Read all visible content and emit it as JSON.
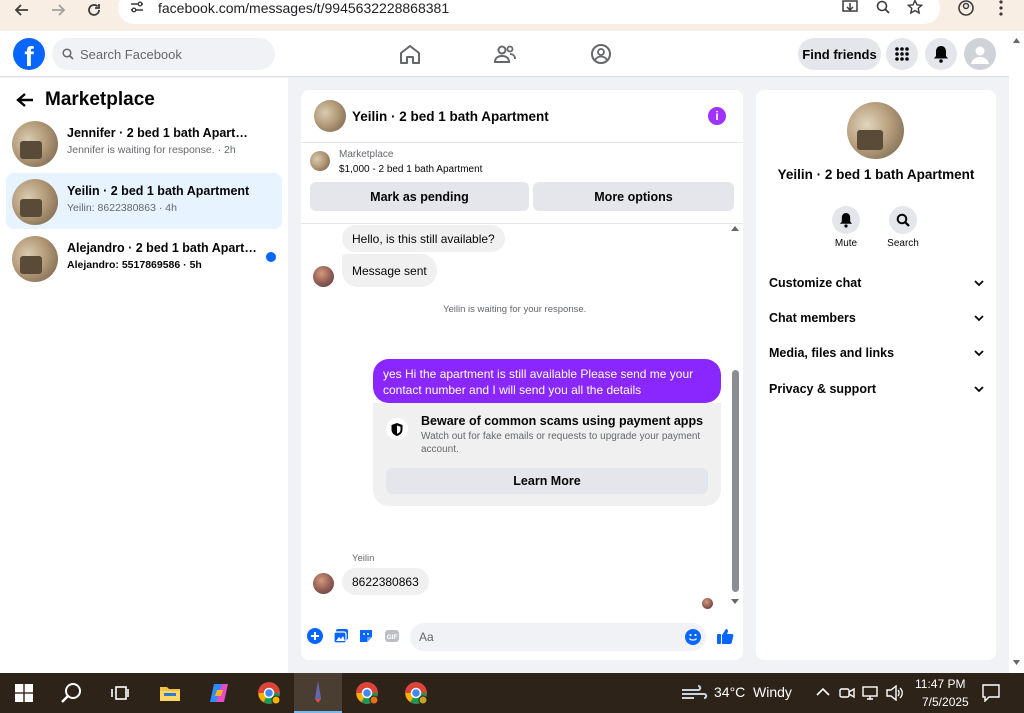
{
  "browser": {
    "url": "facebook.com/messages/t/9945632228868381"
  },
  "header": {
    "search_placeholder": "Search Facebook",
    "find_friends": "Find friends"
  },
  "sidebar": {
    "title": "Marketplace",
    "conversations": [
      {
        "name": "Jennifer · 2 bed 1 bath Apartment",
        "subtitle": "Jennifer is waiting for response. · 2h",
        "unread": false,
        "active": false
      },
      {
        "name": "Yeilin · 2 bed 1 bath Apartment",
        "subtitle": "Yeilin: 8622380863 · 4h",
        "unread": false,
        "active": true
      },
      {
        "name": "Alejandro · 2 bed 1 bath Apartm...",
        "subtitle": "Alejandro: 5517869586 · 5h",
        "unread": true,
        "active": false
      }
    ]
  },
  "chat": {
    "title": "Yeilin · 2 bed 1 bath Apartment",
    "marketplace_label": "Marketplace",
    "listing": "$1,000 - 2 bed 1 bath Apartment",
    "mark_pending": "Mark as pending",
    "more_options": "More options",
    "messages": {
      "incoming_1": "Hello, is this still available?",
      "incoming_2": "Message sent",
      "status_waiting": "Yeilin is waiting for your response.",
      "outgoing": "yes Hi the apartment is still available Please send me your contact number and I will send you all the details",
      "sender_label": "Yeilin",
      "incoming_3": "8622380863"
    },
    "scam_warning": {
      "title": "Beware of common scams using payment apps",
      "body": "Watch out for fake emails or requests to upgrade your payment account.",
      "button": "Learn More"
    },
    "composer_placeholder": "Aa"
  },
  "details": {
    "title": "Yeilin · 2 bed 1 bath Apartment",
    "mute": "Mute",
    "search": "Search",
    "sections": [
      "Customize chat",
      "Chat members",
      "Media, files and links",
      "Privacy & support"
    ]
  },
  "taskbar": {
    "temperature": "34°C",
    "weather": "Windy",
    "time": "11:47 PM",
    "date": "7/5/2025"
  },
  "colors": {
    "facebook_blue": "#0866ff",
    "messenger_purple": "#8a27ff",
    "active_row": "#e7f3ff"
  }
}
